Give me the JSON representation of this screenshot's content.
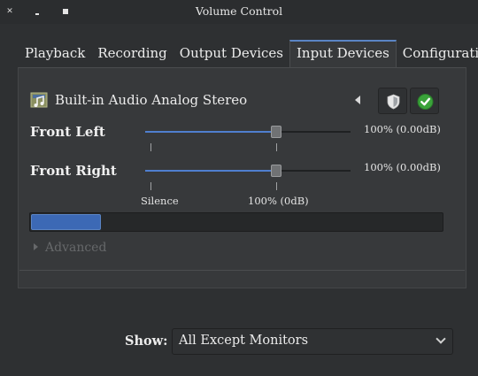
{
  "window": {
    "title": "Volume Control",
    "close_glyph": "✕"
  },
  "tabs": [
    {
      "label": "Playback",
      "active": false
    },
    {
      "label": "Recording",
      "active": false
    },
    {
      "label": "Output Devices",
      "active": false
    },
    {
      "label": "Input Devices",
      "active": true
    },
    {
      "label": "Configuration",
      "active": false
    }
  ],
  "device": {
    "name": "Built-in Audio Analog Stereo",
    "icon": "audio-card-icon",
    "lock_icon": "shield-icon",
    "default_icon": "check-icon"
  },
  "channels": [
    {
      "label": "Front Left",
      "volume_text": "100% (0.00dB)",
      "level": 0.64
    },
    {
      "label": "Front Right",
      "volume_text": "100% (0.00dB)",
      "level": 0.64
    }
  ],
  "scale": {
    "silence_label": "Silence",
    "base_label": "100% (0dB)"
  },
  "meter": {
    "level": 0.17
  },
  "advanced": {
    "label": "Advanced"
  },
  "footer": {
    "show_label": "Show:",
    "show_value": "All Except Monitors"
  },
  "colors": {
    "accent": "#4f7fcf",
    "background": "#2e3032",
    "panel": "#37393b",
    "check_green": "#3aa33a"
  }
}
